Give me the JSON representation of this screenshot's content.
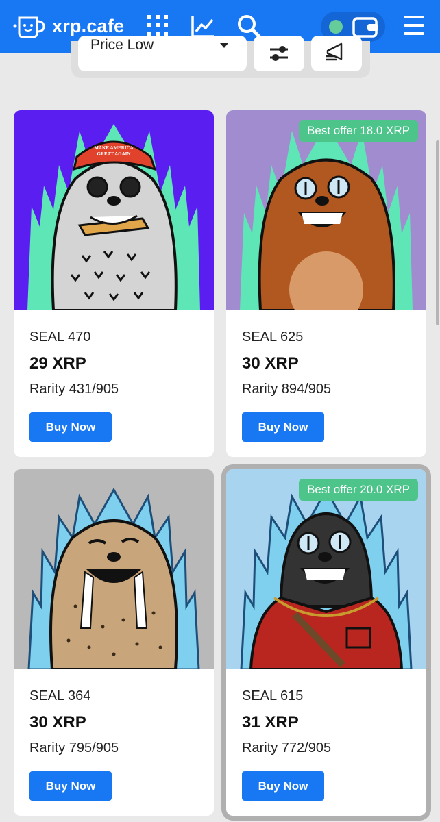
{
  "header": {
    "logo_text": "xrp.cafe",
    "icons": [
      "cup-icon",
      "grid-icon",
      "chart-icon",
      "search-icon",
      "status-dot-icon",
      "wallet-icon",
      "menu-icon"
    ]
  },
  "filters": {
    "sort_label": "Price Low",
    "icons": [
      "chevron-down-icon",
      "sliders-icon",
      "megaphone-icon"
    ]
  },
  "colors": {
    "brand": "#1877f2",
    "offer_badge": "#4cc48a",
    "status_dot": "#66cc99"
  },
  "cards": [
    {
      "name": "SEAL 470",
      "price": "29 XRP",
      "rarity": "Rarity 431/905",
      "buy_label": "Buy Now",
      "offer": "",
      "image": "seal-with-red-cap-image",
      "hat_text_1": "MAKE AMERICA",
      "hat_text_2": "GREAT AGAIN"
    },
    {
      "name": "SEAL 625",
      "price": "30 XRP",
      "rarity": "Rarity 894/905",
      "buy_label": "Buy Now",
      "offer": "Best offer 18.0 XRP",
      "image": "brown-seal-image"
    },
    {
      "name": "SEAL 364",
      "price": "30 XRP",
      "rarity": "Rarity 795/905",
      "buy_label": "Buy Now",
      "offer": "",
      "image": "walrus-image"
    },
    {
      "name": "SEAL 615",
      "price": "31 XRP",
      "rarity": "Rarity 772/905",
      "buy_label": "Buy Now",
      "offer": "Best offer 20.0 XRP",
      "image": "seal-in-red-jacket-image"
    }
  ]
}
